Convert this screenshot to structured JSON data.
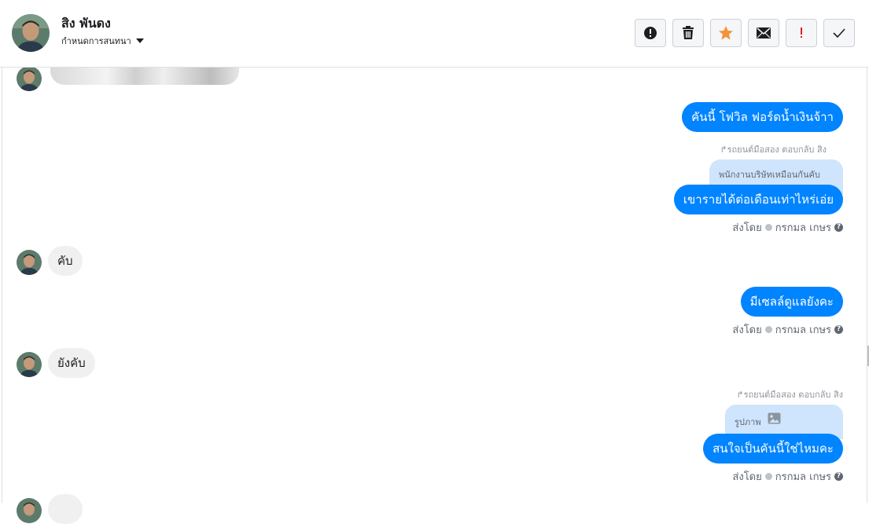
{
  "header": {
    "contact_name": "สิง พันดง",
    "assign_label": "กำหนดการสนทนา",
    "actions": [
      "info-icon",
      "trash-icon",
      "star-icon",
      "envelope-icon",
      "exclamation-icon",
      "check-icon"
    ],
    "colors": {
      "star": "#f7923a",
      "exclamation": "#e02020",
      "bubble_out": "#0084ff",
      "quote": "#cfe4fd"
    }
  },
  "messages": [
    {
      "from": "customer",
      "type": "image"
    },
    {
      "from": "page",
      "text": "คันนี้ โฟวิล ฟอร์ดน้ำเงินจ้าา"
    },
    {
      "from": "page",
      "reply_meta": "รถยนต์มือสอง ตอบกลับ สิง",
      "reply_quote": "พนักงานบริษัทเหมือนกันคับ",
      "text": "เขารายได้ต่อเดือนเท่าไหร่เอ่ย",
      "sent_by_label": "ส่งโดย",
      "sent_by_name": "กรกมล เกษร"
    },
    {
      "from": "customer",
      "text": "คับ"
    },
    {
      "from": "page",
      "text": "มีเซลล์ดูแลยังคะ",
      "sent_by_label": "ส่งโดย",
      "sent_by_name": "กรกมล เกษร"
    },
    {
      "from": "customer",
      "text": "ยังคับ"
    },
    {
      "from": "page",
      "reply_meta": "รถยนต์มือสอง ตอบกลับ สิง",
      "reply_quote": "รูปภาพ",
      "reply_quote_icon": "image-icon",
      "text": "สนใจเป็นคันนี้ใช่ไหมคะ",
      "sent_by_label": "ส่งโดย",
      "sent_by_name": "กรกมล เกษร"
    }
  ]
}
